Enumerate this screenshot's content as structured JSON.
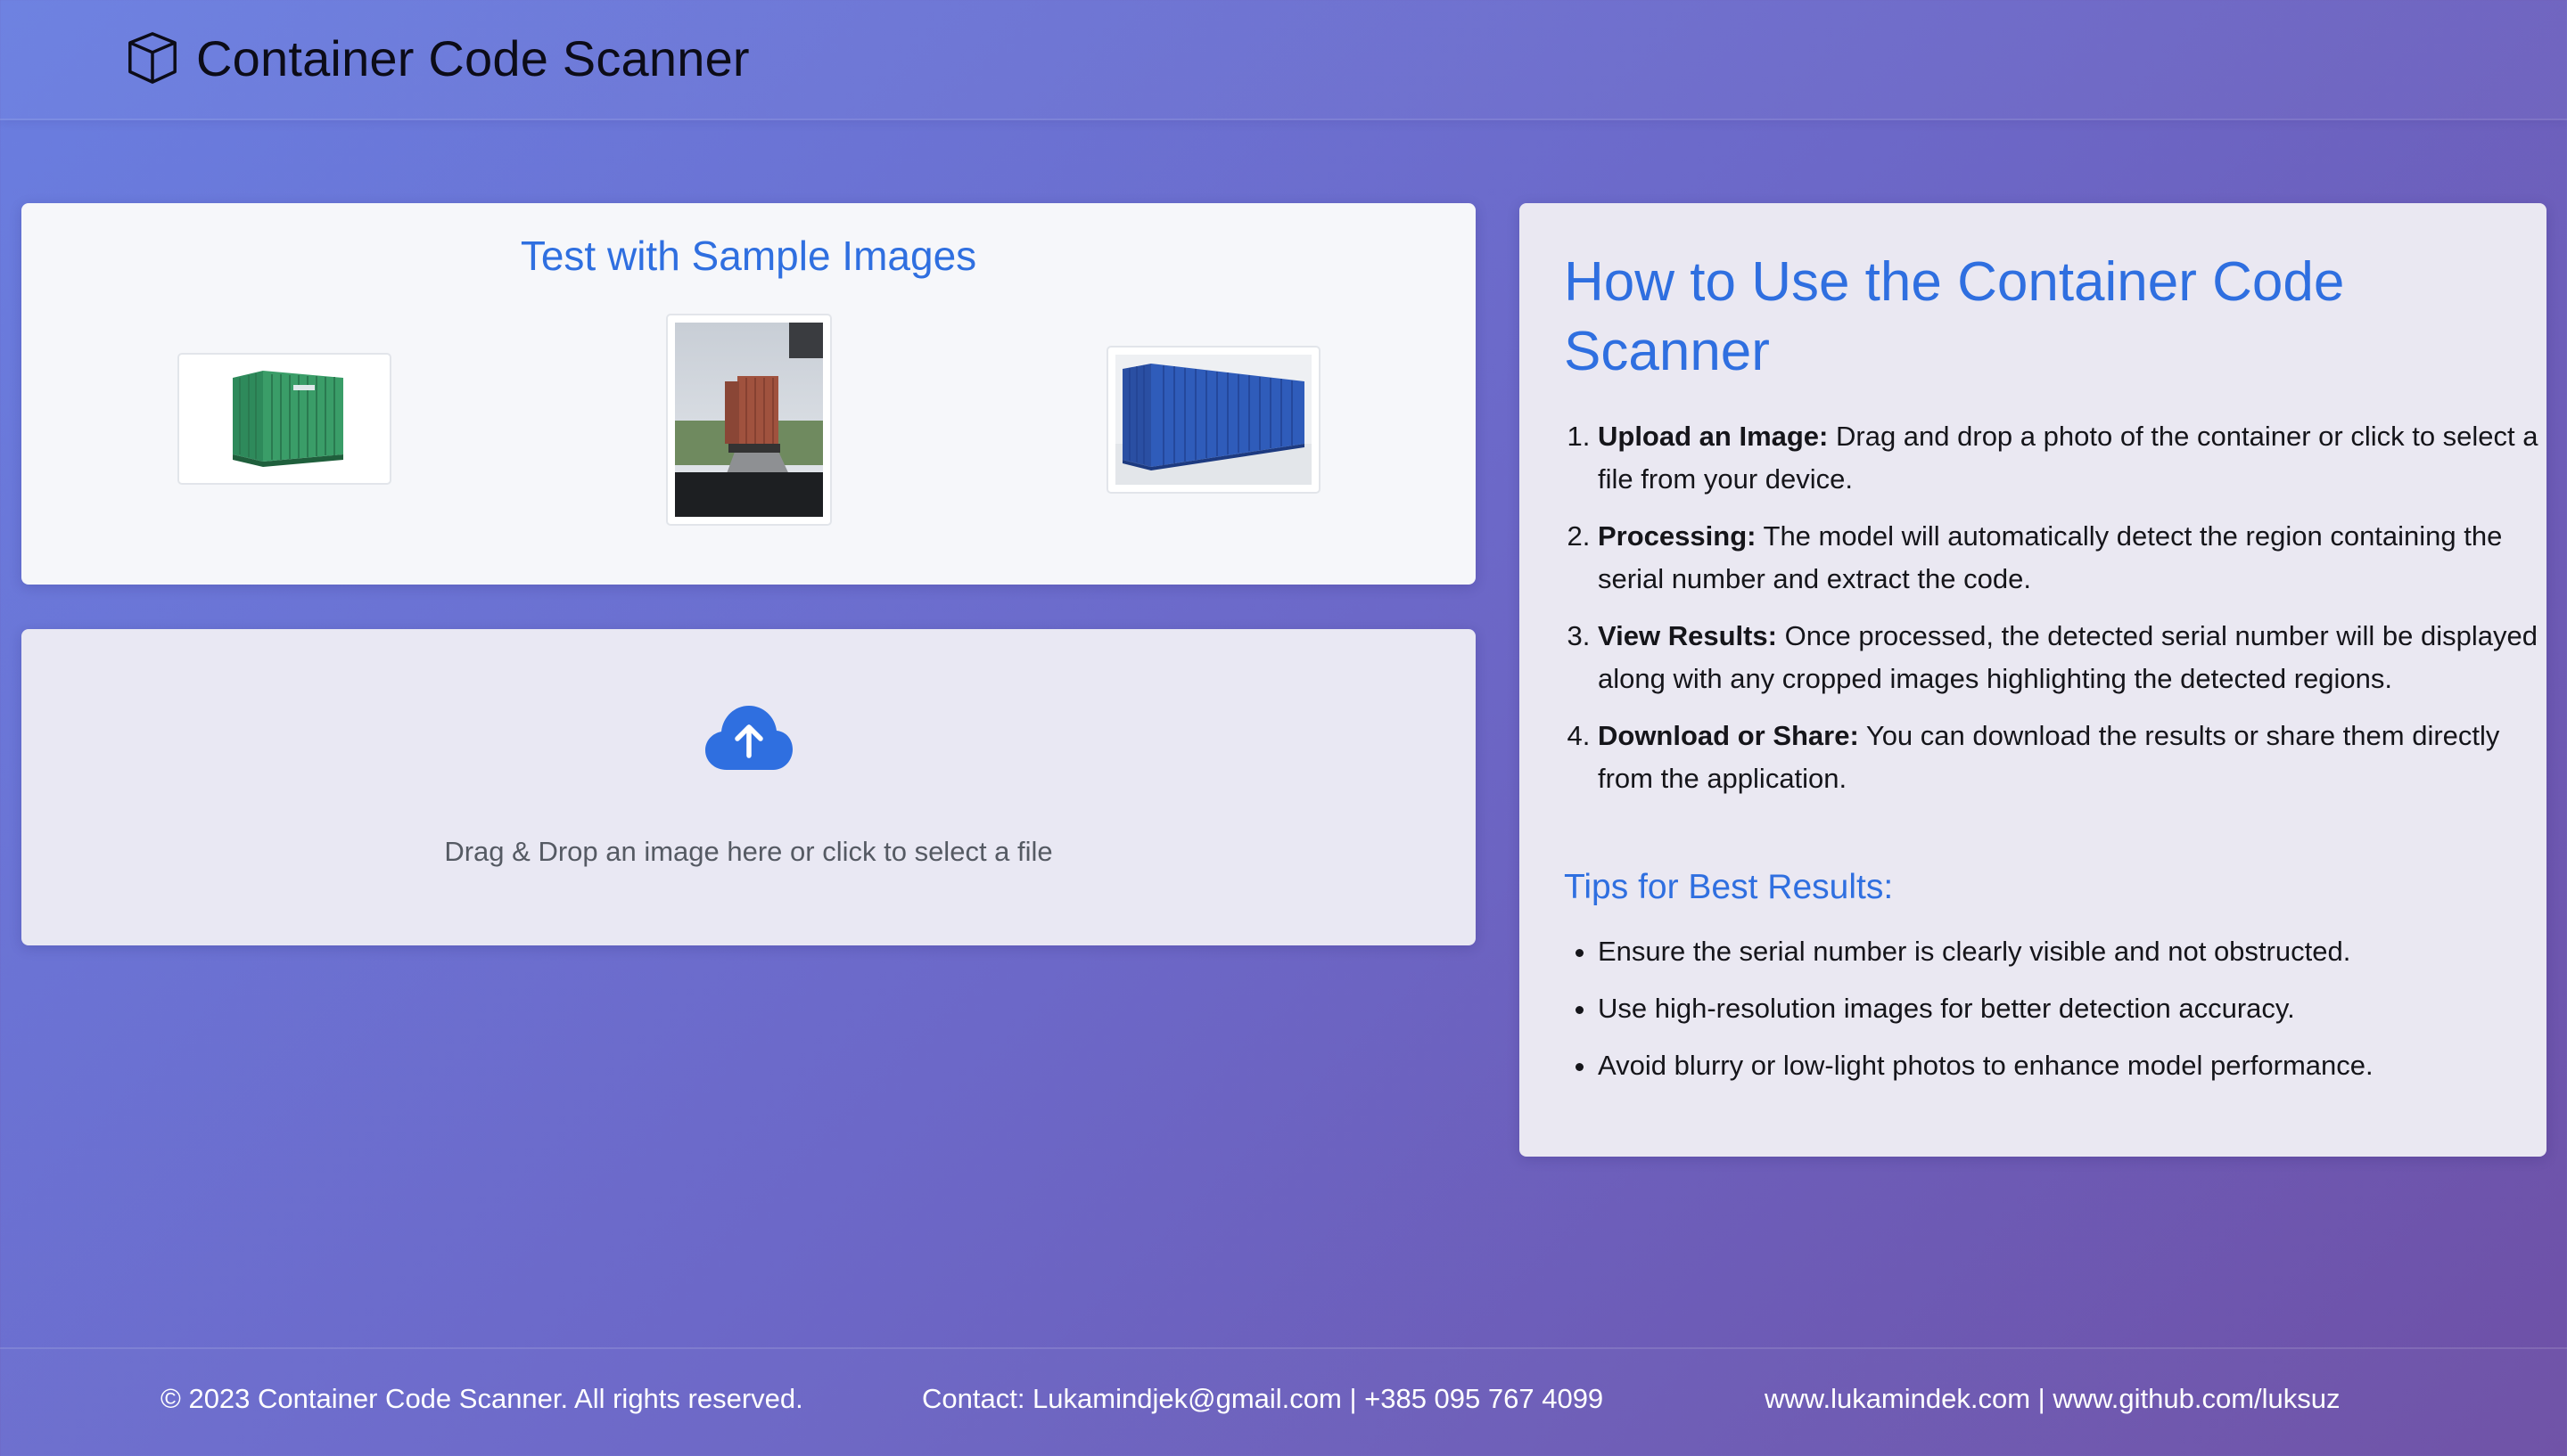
{
  "header": {
    "title": "Container Code Scanner",
    "icon": "box-icon"
  },
  "samples": {
    "title": "Test with Sample Images",
    "images": [
      {
        "name": "green-container-sample",
        "description_icon": "image-thumbnail"
      },
      {
        "name": "truck-container-sample",
        "description_icon": "image-thumbnail"
      },
      {
        "name": "blue-container-sample",
        "description_icon": "image-thumbnail"
      }
    ]
  },
  "upload": {
    "icon": "cloud-upload-icon",
    "text": "Drag & Drop an image here or click to select a file"
  },
  "instructions": {
    "title": "How to Use the Container Code Scanner",
    "steps": [
      {
        "label": "Upload an Image:",
        "text": " Drag and drop a photo of the container or click to select a file from your device."
      },
      {
        "label": "Processing:",
        "text": " The model will automatically detect the region containing the serial number and extract the code."
      },
      {
        "label": "View Results:",
        "text": " Once processed, the detected serial number will be displayed along with any cropped images highlighting the detected regions."
      },
      {
        "label": "Download or Share:",
        "text": " You can download the results or share them directly from the application."
      }
    ],
    "tips_title": "Tips for Best Results:",
    "tips": [
      "Ensure the serial number is clearly visible and not obstructed.",
      "Use high-resolution images for better detection accuracy.",
      "Avoid blurry or low-light photos to enhance model performance."
    ]
  },
  "footer": {
    "copyright": "© 2023 Container Code Scanner. All rights reserved.",
    "contact": "Contact: Lukamindjek@gmail.com | +385 095 767 4099",
    "links": "www.lukamindek.com | www.github.com/luksuz"
  },
  "colors": {
    "accent": "#2f6fe0",
    "background_start": "#6a7ee0",
    "background_end": "#6e50a6"
  }
}
